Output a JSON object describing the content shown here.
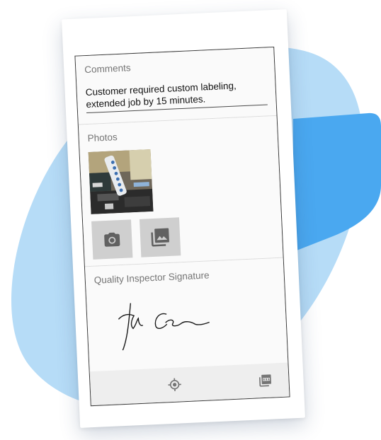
{
  "colors": {
    "blob_light": "#b6dcf7",
    "blob_accent": "#4aa8f0",
    "icon_gray": "#757575",
    "button_gray": "#cfcfcf"
  },
  "comments": {
    "label": "Comments",
    "value": "Customer required custom labeling, extended job by 15 minutes."
  },
  "photos": {
    "label": "Photos",
    "thumbnail_icon": "photo-thumbnail",
    "camera_icon": "camera-icon",
    "gallery_icon": "image-gallery-icon"
  },
  "signature": {
    "label": "Quality Inspector Signature"
  },
  "bottom_bar": {
    "left_icon": "gps-location-icon",
    "right_icon": "pdf-icon"
  }
}
